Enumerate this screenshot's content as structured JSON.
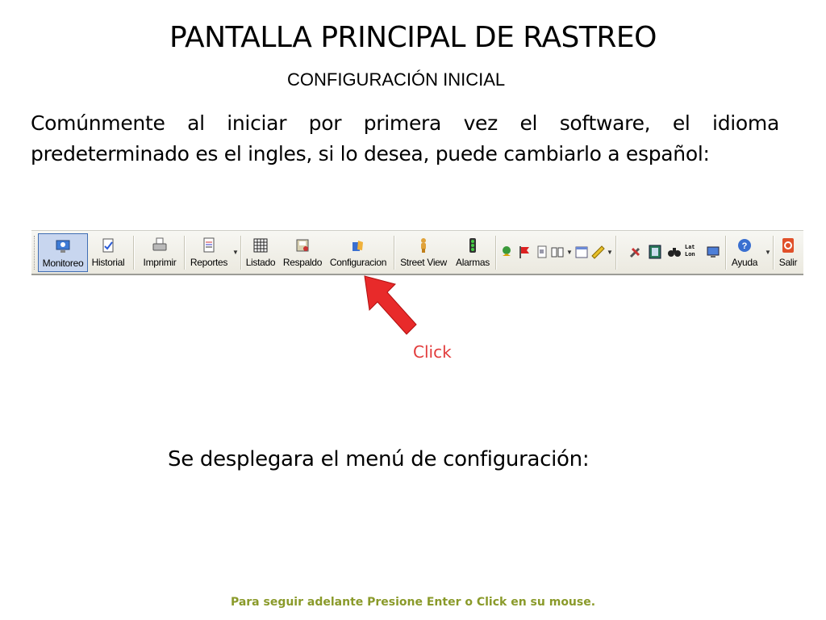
{
  "slide": {
    "title": "PANTALLA PRINCIPAL DE RASTREO",
    "subtitle": "CONFIGURACIÓN INICIAL",
    "intro": "Comúnmente al iniciar por primera vez el software, el idioma predeterminado es el ingles, si lo desea, puede cambiarlo a español:",
    "click_label": "Click",
    "menu_note": "Se desplegara el menú de configuración:",
    "footer": "Para seguir adelante Presione Enter o Click en su mouse."
  },
  "toolbar": {
    "buttons": [
      {
        "label": "Monitoreo",
        "icon": "monitor-icon",
        "active": true
      },
      {
        "label": "Historial",
        "icon": "history-icon"
      },
      {
        "label": "Imprimir",
        "icon": "printer-icon"
      },
      {
        "label": "Reportes",
        "icon": "reports-icon"
      },
      {
        "label": "Listado",
        "icon": "grid-list-icon"
      },
      {
        "label": "Respaldo",
        "icon": "backup-icon"
      },
      {
        "label": "Configuracion",
        "icon": "configuration-icon"
      },
      {
        "label": "Street View",
        "icon": "street-view-person-icon"
      },
      {
        "label": "Alarmas",
        "icon": "traffic-light-icon"
      },
      {
        "label": "Ayuda",
        "icon": "help-icon"
      },
      {
        "label": "Salir",
        "icon": "exit-icon"
      }
    ],
    "small_icons": [
      "geo-pin-icon",
      "flag-icon",
      "document-icon",
      "book-icon",
      "calendar-icon",
      "ruler-icon",
      "tools-icon",
      "film-icon",
      "binoculars-icon",
      "lat-lon-icon",
      "screen-icon"
    ],
    "latlon_text": {
      "lat": "Lat",
      "lon": "Lon"
    }
  },
  "colors": {
    "accent_red": "#e23b3b",
    "footer_green": "#8a9a2a",
    "active_button": "#c8d6ef"
  }
}
